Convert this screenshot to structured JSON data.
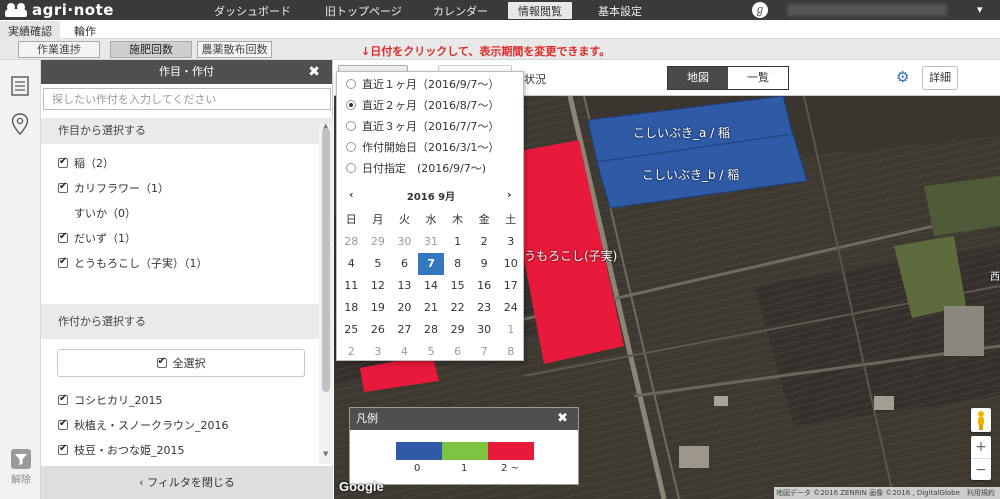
{
  "app": {
    "logo_text": "agri·note"
  },
  "topnav": {
    "items": [
      "ダッシュボード",
      "旧トップページ",
      "カレンダー",
      "情報閲覧",
      "基本設定"
    ],
    "active": "情報閲覧",
    "avatar_glyph": "ℊ"
  },
  "subnav": {
    "tabs": [
      "実績確認",
      "輪作"
    ],
    "active_tab": "実績確認",
    "pills": [
      "作業進捗",
      "施肥回数",
      "農薬散布回数"
    ],
    "active_pill": "施肥回数",
    "notice": "↓日付をクリックして、表示期間を変更できます。"
  },
  "rail": {
    "cancel_label": "解除"
  },
  "panel": {
    "title": "作目・作付",
    "search_placeholder": "探したい作付を入力してください",
    "section_crop": "作目から選択する",
    "crops": [
      {
        "label": "稲（2）",
        "checked": true
      },
      {
        "label": "カリフラワー（1）",
        "checked": true
      },
      {
        "label": "すいか（0）",
        "checked": false,
        "disabled": true
      },
      {
        "label": "だいず（1）",
        "checked": true
      },
      {
        "label": "とうもろこし（子実）（1）",
        "checked": true
      }
    ],
    "section_plant": "作付から選択する",
    "select_all": "全選択",
    "plantings": [
      {
        "label": "コシヒカリ_2015",
        "checked": true
      },
      {
        "label": "秋植え・スノークラウン_2016",
        "checked": true
      },
      {
        "label": "枝豆・おつな姫_2015",
        "checked": true
      }
    ],
    "footer": "フィルタを閉じる"
  },
  "toolbar": {
    "mode_label": "状況",
    "seg_map": "地図",
    "seg_list": "一覧",
    "detail": "詳細"
  },
  "datepop": {
    "options": [
      {
        "label": "直近１ヶ月（2016/9/7〜）",
        "selected": false
      },
      {
        "label": "直近２ヶ月（2016/8/7〜）",
        "selected": true
      },
      {
        "label": "直近３ヶ月（2016/7/7〜）",
        "selected": false
      },
      {
        "label": "作付開始日（2016/3/1〜）",
        "selected": false
      },
      {
        "label": "日付指定　(2016/9/7〜)",
        "selected": false
      }
    ],
    "calendar": {
      "title": "2016 9月",
      "prev": "‹",
      "next": "›",
      "weekdays": [
        "日",
        "月",
        "火",
        "水",
        "木",
        "金",
        "土"
      ],
      "weeks": [
        [
          28,
          29,
          30,
          31,
          1,
          2,
          3
        ],
        [
          4,
          5,
          6,
          7,
          8,
          9,
          10
        ],
        [
          11,
          12,
          13,
          14,
          15,
          16,
          17
        ],
        [
          18,
          19,
          20,
          21,
          22,
          23,
          24
        ],
        [
          25,
          26,
          27,
          28,
          29,
          30,
          1
        ],
        [
          2,
          3,
          4,
          5,
          6,
          7,
          8
        ]
      ],
      "today": 7
    }
  },
  "map": {
    "fields": [
      {
        "label": "こしいぶき_a / 稲",
        "count": "0"
      },
      {
        "label": "こしいぶき_b / 稲",
        "count": "0"
      },
      {
        "label": "うもろこし(子実)",
        "count": "2~"
      }
    ],
    "edge_label": "西",
    "google": "Google",
    "attribution": "地図データ ©2016 ZENRIN 画像 ©2016 , DigitalGlobe　利用規約"
  },
  "legend": {
    "title": "凡例",
    "colors": [
      "#2e5aa6",
      "#7ec242",
      "#e8193a"
    ],
    "labels": [
      "0",
      "1",
      "2 ~"
    ]
  }
}
